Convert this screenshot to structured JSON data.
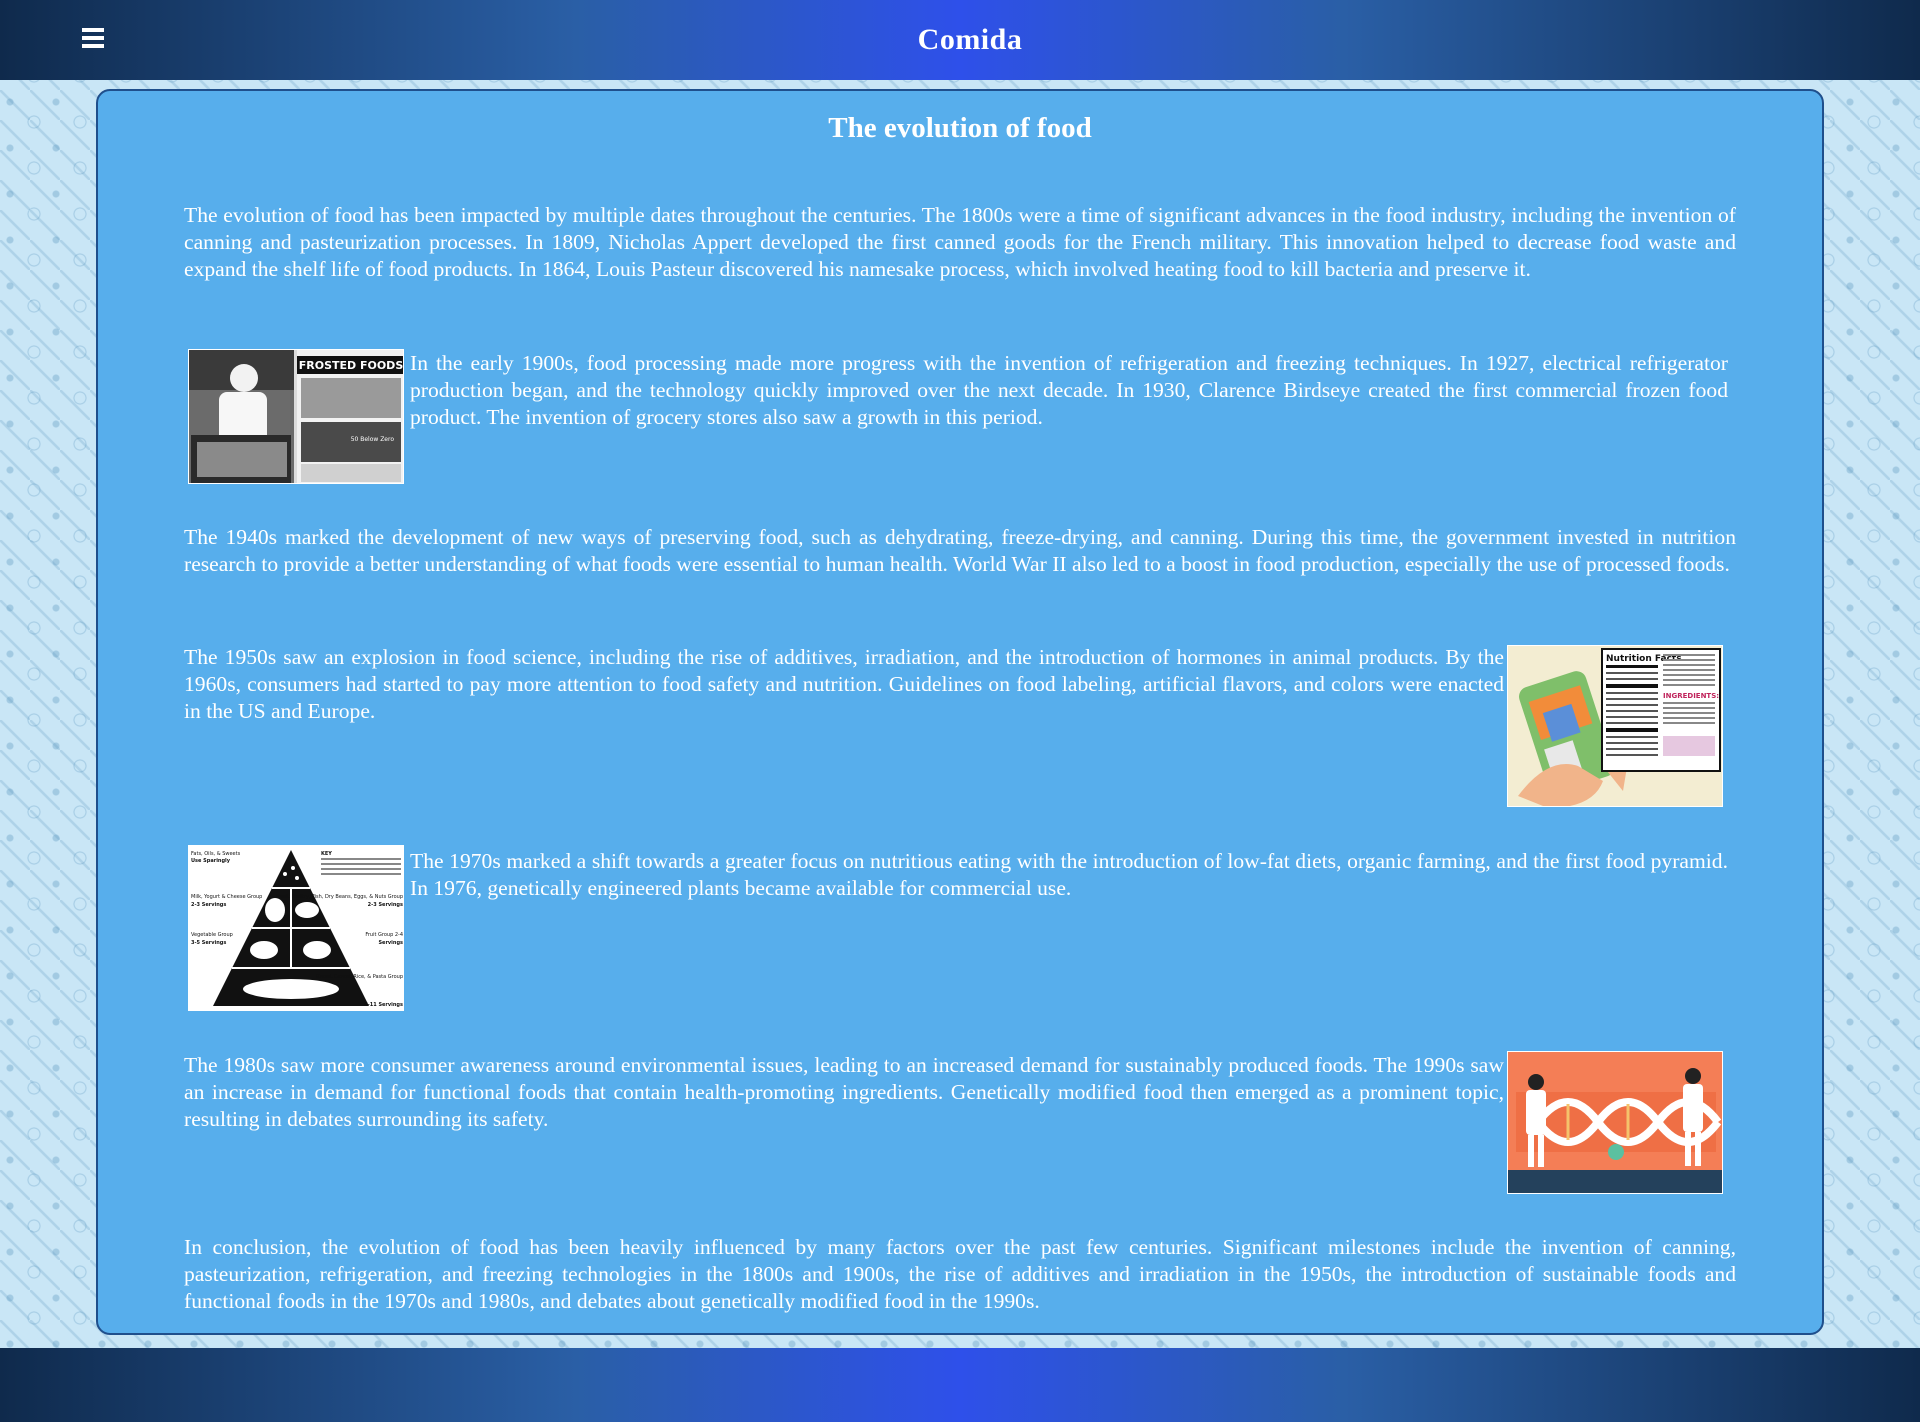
{
  "header": {
    "title": "Comida"
  },
  "article": {
    "title": "The evolution of food",
    "paragraphs": [
      "The evolution of food has been impacted by multiple dates throughout the centuries. The 1800s were a time of significant advances in the food industry, including the invention of canning and pasteurization processes. In 1809, Nicholas Appert developed the first canned goods for the French military. This innovation helped to decrease food waste and expand the shelf life of food products. In 1864, Louis Pasteur discovered his namesake process, which involved heating food to kill bacteria and preserve it.",
      "In the early 1900s, food processing made more progress with the invention of refrigeration and freezing techniques. In 1927, electrical refrigerator production began, and the technology quickly improved over the next decade. In 1930, Clarence Birdseye created the first commercial frozen food product. The invention of grocery stores also saw a growth in this period.",
      "The 1940s marked the development of new ways of preserving food, such as dehydrating, freeze-drying, and canning. During this time, the government invested in nutrition research to provide a better understanding of what foods were essential to human health. World War II also led to a boost in food production, especially the use of processed foods.",
      "The 1950s saw an explosion in food science, including the rise of additives, irradiation, and the introduction of hormones in animal products. By the 1960s, consumers had started to pay more attention to food safety and nutrition. Guidelines on food labeling, artificial flavors, and colors were enacted in the US and Europe.",
      "The 1970s marked a shift towards a greater focus on nutritious eating with the introduction of low-fat diets, organic farming, and the first food pyramid. In 1976, genetically engineered plants became available for commercial use.",
      "The 1980s saw more consumer awareness around environmental issues, leading to an increased demand for sustainably produced foods. The 1990s saw an increase in demand for functional foods that contain health-promoting ingredients. Genetically modified food then emerged as a prominent topic, resulting in debates surrounding its safety.",
      "In conclusion, the evolution of food has been heavily influenced by many factors over the past few centuries. Significant milestones include the invention of canning, pasteurization, refrigeration, and freezing technologies in the 1800s and 1900s, the rise of additives and irradiation in the 1950s, the introduction of sustainable foods and functional foods in the 1970s and 1980s, and debates about genetically modified food in the 1990s."
    ]
  },
  "images": {
    "frozen_foods_sign": "FROSTED FOODS",
    "frozen_foods_price": "50 Below Zero",
    "nutrition_title": "Nutrition Facts",
    "ingredients_label": "INGREDIENTS:",
    "pyramid_labels": {
      "top": "Fats, Oils, & Sweets",
      "top_sub": "Use Sparingly",
      "key": "KEY",
      "milk": "Milk, Yogurt & Cheese Group",
      "milk_servings": "2-3 Servings",
      "meat": "Meat, Poultry, Fish, Dry Beans, Eggs, & Nuts Group",
      "meat_servings": "2-3 Servings",
      "veg": "Vegetable Group",
      "veg_servings": "3-5 Servings",
      "fruit": "Fruit Group 2-4",
      "fruit_servings": "Servings",
      "bread": "Bread, Cereal, Rice, & Pasta Group",
      "bread_servings": "6-11 Servings"
    }
  },
  "colors": {
    "header_gradient_center": "#2e50ea",
    "header_gradient_edge": "#0f2a4c",
    "panel_background": "#57aeec",
    "panel_border": "#1f4f8c",
    "text": "#ffffff"
  }
}
